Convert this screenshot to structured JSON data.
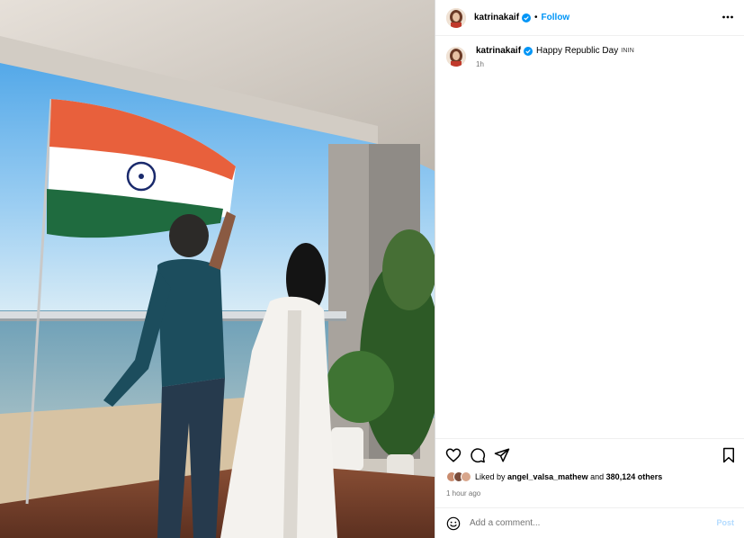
{
  "post": {
    "username": "katrinakaif",
    "follow_label": "Follow",
    "separator": "•",
    "caption_text": "Happy Republic Day",
    "caption_tag": "ININ",
    "caption_time": "1h",
    "likes_prefix": "Liked by",
    "likes_user": "angel_valsa_mathew",
    "likes_and": "and",
    "likes_count": "380,124 others",
    "posted_time": "1 hour ago"
  },
  "comment": {
    "placeholder": "Add a comment...",
    "post_label": "Post"
  },
  "icons": {
    "verified": "verified-badge-icon",
    "more": "more-options-icon",
    "like": "heart-icon",
    "comment": "comment-icon",
    "share": "share-icon",
    "save": "bookmark-icon",
    "emoji": "emoji-icon"
  },
  "colors": {
    "accent": "#0095f6",
    "verified": "#0095f6",
    "post_disabled": "#b3dbff",
    "flag_saffron": "#e8603c",
    "flag_green": "#1f6b3f",
    "chakra": "#1a2a6c"
  }
}
